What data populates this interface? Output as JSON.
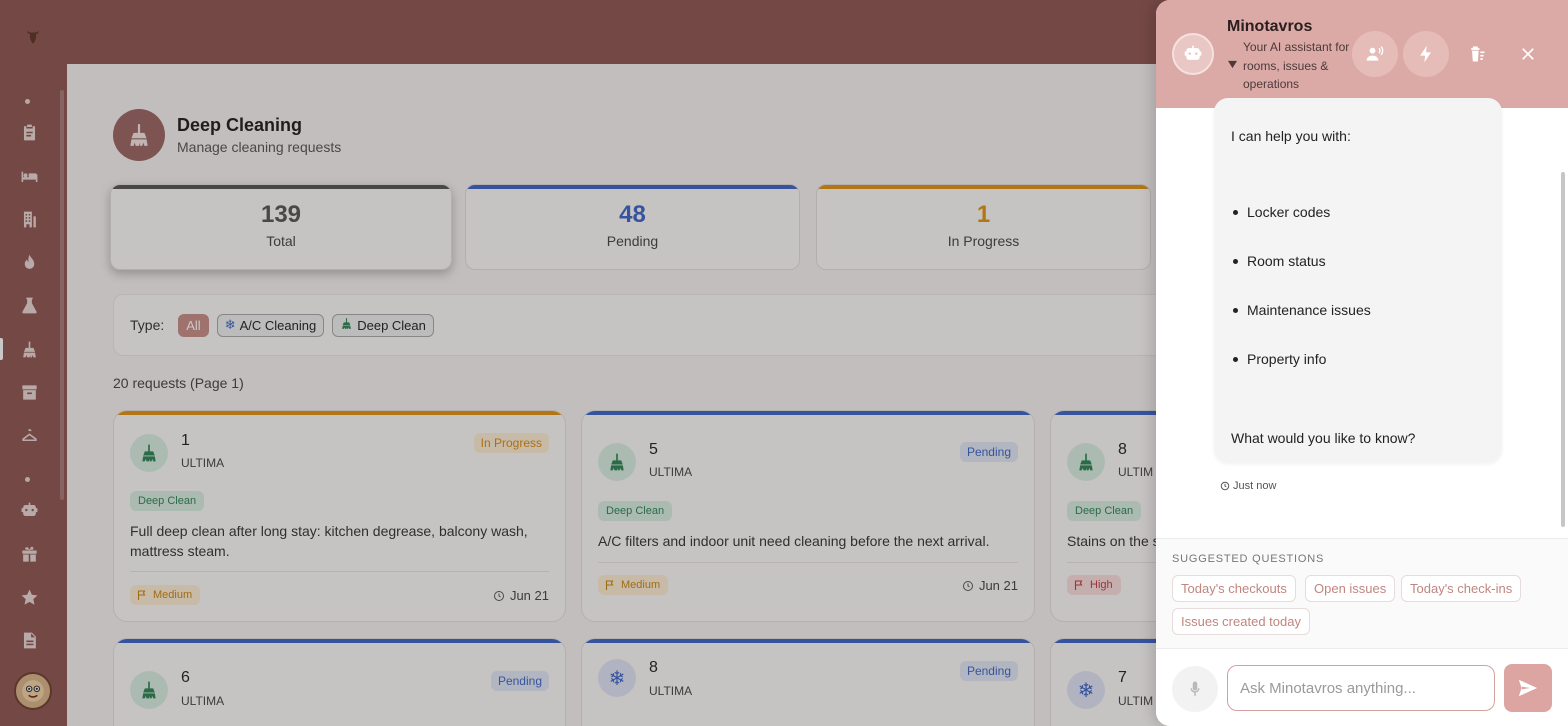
{
  "sidebar": {
    "logo_icon": "bull-logo-icon",
    "items": [
      {
        "icon": "clipboard-icon"
      },
      {
        "icon": "bed-icon"
      },
      {
        "icon": "building-icon"
      },
      {
        "icon": "flame-icon"
      },
      {
        "icon": "flask-icon"
      },
      {
        "icon": "broom-icon",
        "active": true
      },
      {
        "icon": "archive-icon"
      },
      {
        "icon": "hanger-icon"
      },
      {
        "icon": "robot-icon"
      },
      {
        "icon": "gift-icon"
      },
      {
        "icon": "star-icon"
      },
      {
        "icon": "document-icon"
      }
    ],
    "avatar_icon": "user-avatar"
  },
  "page": {
    "title": "Deep Cleaning",
    "subtitle": "Manage cleaning requests"
  },
  "stats": [
    {
      "value": "139",
      "label": "Total",
      "color": "#555555"
    },
    {
      "value": "48",
      "label": "Pending",
      "color": "#3b66c8"
    },
    {
      "value": "1",
      "label": "In Progress",
      "color": "#e0950f"
    }
  ],
  "filter": {
    "label": "Type:",
    "chips": [
      {
        "label": "All",
        "icon": ""
      },
      {
        "label": "A/C Cleaning",
        "icon": "snowflake-icon"
      },
      {
        "label": "Deep Clean",
        "icon": "broom-icon"
      }
    ]
  },
  "requests_count": "20 requests (Page 1)",
  "cards": [
    {
      "number": "1",
      "property": "ULTIMA",
      "status": "In Progress",
      "type": "Deep Clean",
      "description": "Full deep clean after long stay: kitchen degrease, balcony wash, mattress steam.",
      "priority": "Medium",
      "date": "Jun 21",
      "icon": "broom-icon"
    },
    {
      "number": "5",
      "property": "ULTIMA",
      "status": "Pending",
      "type": "Deep Clean",
      "description": "A/C filters and indoor unit need cleaning before the next arrival.",
      "priority": "Medium",
      "date": "Jun 21",
      "icon": "broom-icon"
    },
    {
      "number": "8",
      "property": "ULTIM",
      "status": "",
      "type": "Deep Clean",
      "description": "Stains on the s",
      "priority": "High",
      "date": "",
      "icon": "broom-icon"
    },
    {
      "number": "6",
      "property": "ULTIMA",
      "status": "Pending",
      "icon": "broom-icon"
    },
    {
      "number": "8",
      "property": "ULTIMA",
      "status": "Pending",
      "icon": "snowflake-icon"
    },
    {
      "number": "7",
      "property": "ULTIM",
      "status": "",
      "icon": "snowflake-icon"
    }
  ],
  "chat": {
    "title": "Minotavros",
    "subtitle": "Your AI assistant for rooms, issues & operations",
    "header_buttons": [
      "voice-icon",
      "lightning-icon",
      "clear-chat-icon",
      "close-icon"
    ],
    "message": {
      "intro": "I can help you with:",
      "items": [
        "Locker codes",
        "Room status",
        "Maintenance issues",
        "Property info"
      ],
      "outro": "What would you like to know?",
      "time": "Just now"
    },
    "suggested_title": "SUGGESTED QUESTIONS",
    "suggestions": [
      "Today's checkouts",
      "Open issues",
      "Today's check-ins",
      "Issues created today"
    ],
    "input_placeholder": "Ask Minotavros anything..."
  }
}
